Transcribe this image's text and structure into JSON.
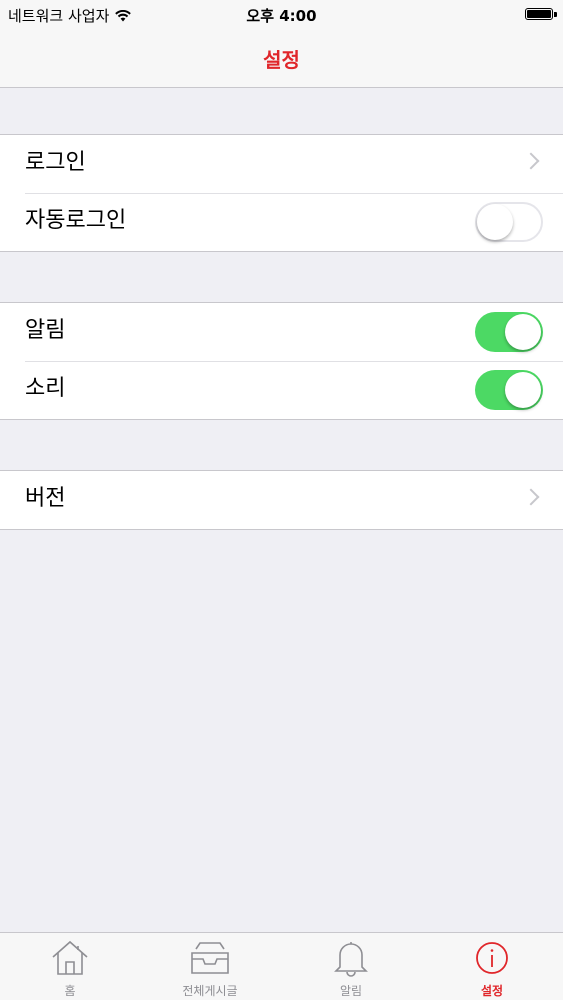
{
  "status_bar": {
    "carrier": "네트워크 사업자",
    "time": "오후 4:00",
    "wifi_icon": "wifi-icon",
    "battery_icon": "battery-icon"
  },
  "nav": {
    "title": "설정"
  },
  "groups": [
    {
      "rows": [
        {
          "label": "로그인",
          "accessory": "chevron"
        },
        {
          "label": "자동로그인",
          "accessory": "switch",
          "on": false
        }
      ]
    },
    {
      "rows": [
        {
          "label": "알림",
          "accessory": "switch",
          "on": true
        },
        {
          "label": "소리",
          "accessory": "switch",
          "on": true
        }
      ]
    },
    {
      "rows": [
        {
          "label": "버전",
          "accessory": "chevron"
        }
      ]
    }
  ],
  "tabs": [
    {
      "label": "홈",
      "icon": "home-icon",
      "active": false
    },
    {
      "label": "전체게시글",
      "icon": "inbox-icon",
      "active": false
    },
    {
      "label": "알림",
      "icon": "bell-icon",
      "active": false
    },
    {
      "label": "설정",
      "icon": "info-icon",
      "active": true
    }
  ],
  "colors": {
    "accent": "#e0262a",
    "switch_on": "#4cd964",
    "background": "#efeff4"
  }
}
